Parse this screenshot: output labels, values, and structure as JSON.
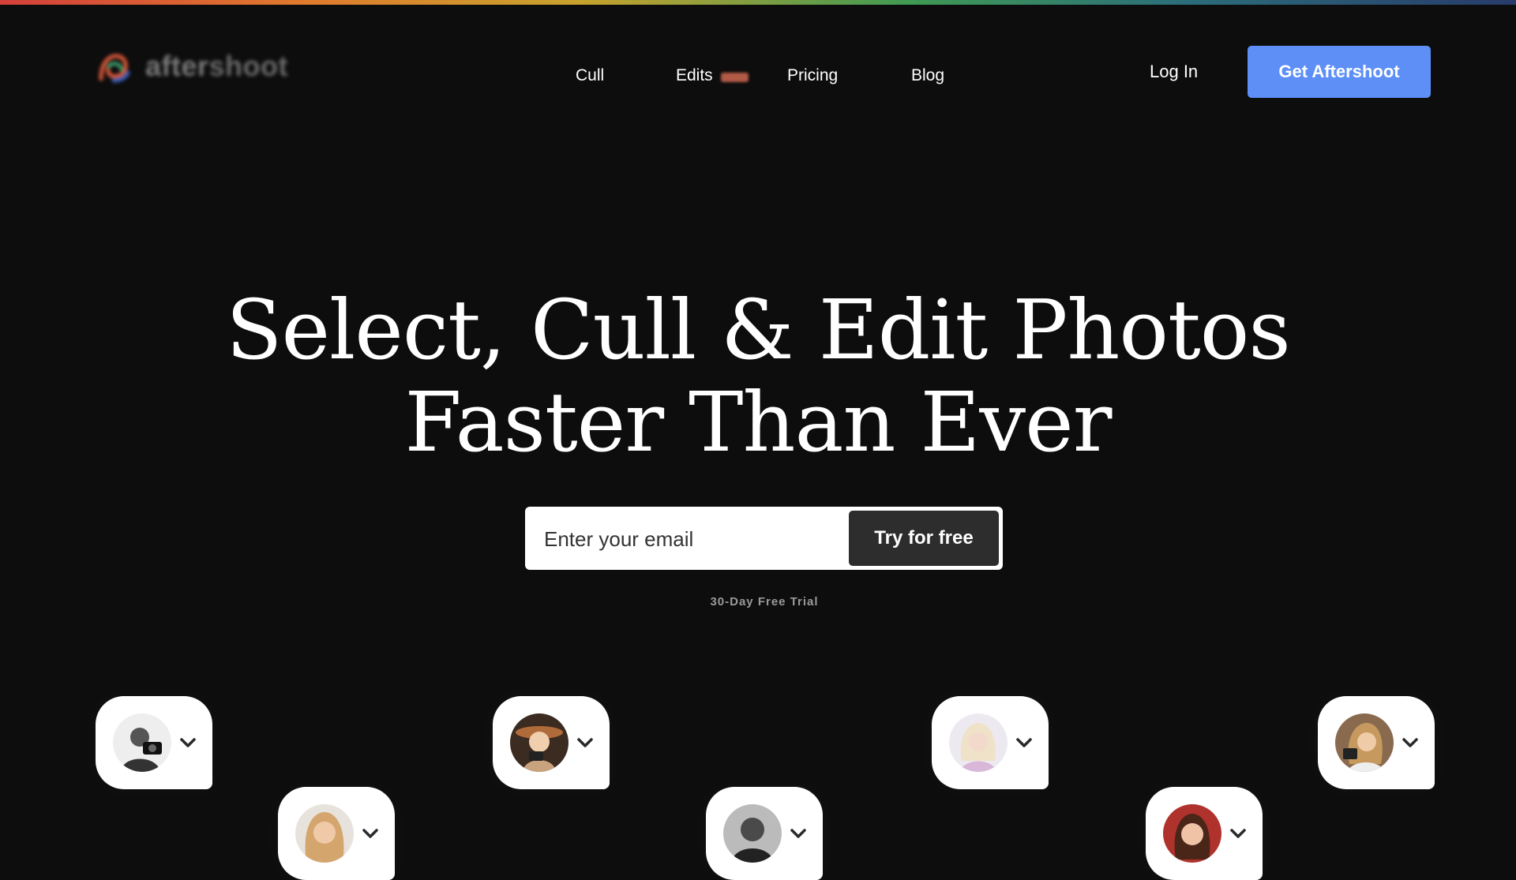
{
  "brand": {
    "name": "aftershoot",
    "name_part1": "after",
    "name_part2": "shoot",
    "accent": "#5d8ff7"
  },
  "nav": {
    "links": [
      "Cull",
      "Edits",
      "Pricing",
      "Blog"
    ],
    "login": "Log In",
    "cta": "Get Aftershoot"
  },
  "hero": {
    "title_line1": "Select, Cull & Edit Photos",
    "title_line2": "Faster Than Ever",
    "email_placeholder": "Enter your email",
    "try_button": "Try for free",
    "trial_note": "30-Day Free Trial"
  },
  "profiles": [
    {
      "icon": "photographer-avatar-1",
      "tone": "#c8c8c8"
    },
    {
      "icon": "photographer-avatar-2",
      "tone": "#d9b08a"
    },
    {
      "icon": "photographer-avatar-3",
      "tone": "#6b4a33"
    },
    {
      "icon": "photographer-avatar-4",
      "tone": "#3a3a3a"
    },
    {
      "icon": "photographer-avatar-5",
      "tone": "#e6d1e3"
    },
    {
      "icon": "photographer-avatar-6",
      "tone": "#b23a35"
    },
    {
      "icon": "photographer-avatar-7",
      "tone": "#8a6a4f"
    }
  ]
}
